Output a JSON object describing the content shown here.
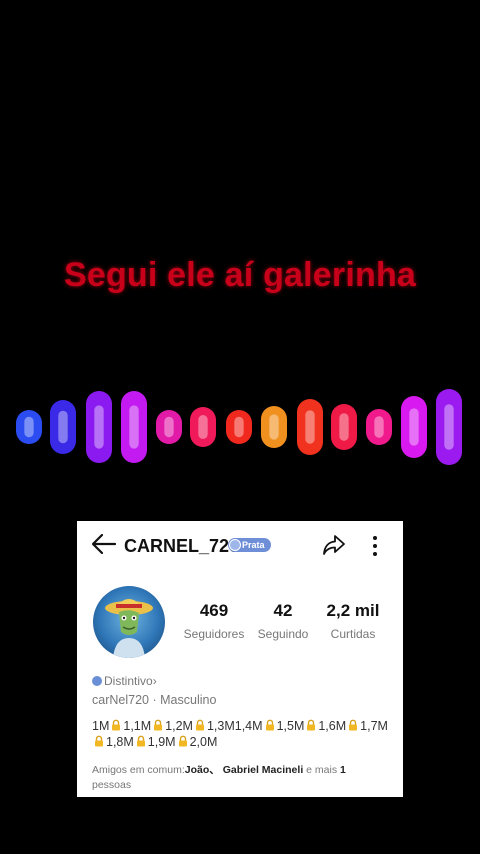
{
  "caption": "Segui ele aí galerinha",
  "visualizer": {
    "bars": [
      {
        "color": "#2a4cf0"
      },
      {
        "color": "#3a2ae8"
      },
      {
        "color": "#8a1af0"
      },
      {
        "color": "#c21af0"
      },
      {
        "color": "#e21aa8"
      },
      {
        "color": "#f01a5a"
      },
      {
        "color": "#f0281e"
      },
      {
        "color": "#f0901e"
      },
      {
        "color": "#f0321e"
      },
      {
        "color": "#f01a46"
      },
      {
        "color": "#f01a8c"
      },
      {
        "color": "#d81af0"
      },
      {
        "color": "#9a1af0"
      }
    ]
  },
  "profile": {
    "username": "CARNEL_720",
    "badge": "Prata",
    "stats": [
      {
        "value": "469",
        "label": "Seguidores"
      },
      {
        "value": "42",
        "label": "Seguindo"
      },
      {
        "value": "2,2 mil",
        "label": "Curtidas"
      }
    ],
    "distintivo": "Distintivo",
    "distintivo_arrow": "›",
    "handle": "carNel720",
    "separator": "·",
    "gender": "Masculino",
    "milestones": [
      "1M",
      "1,1M",
      "1,2M",
      "1,3M1,4M",
      "1,5M",
      "1,6M",
      "1,7M",
      "1,8M",
      "1,9M",
      "2,0M"
    ],
    "friends": {
      "prefix": "Amigos em comum:",
      "names": "João、 Gabriel Macineli",
      "middle": " e mais ",
      "count": "1",
      "suffix": " pessoas"
    }
  }
}
